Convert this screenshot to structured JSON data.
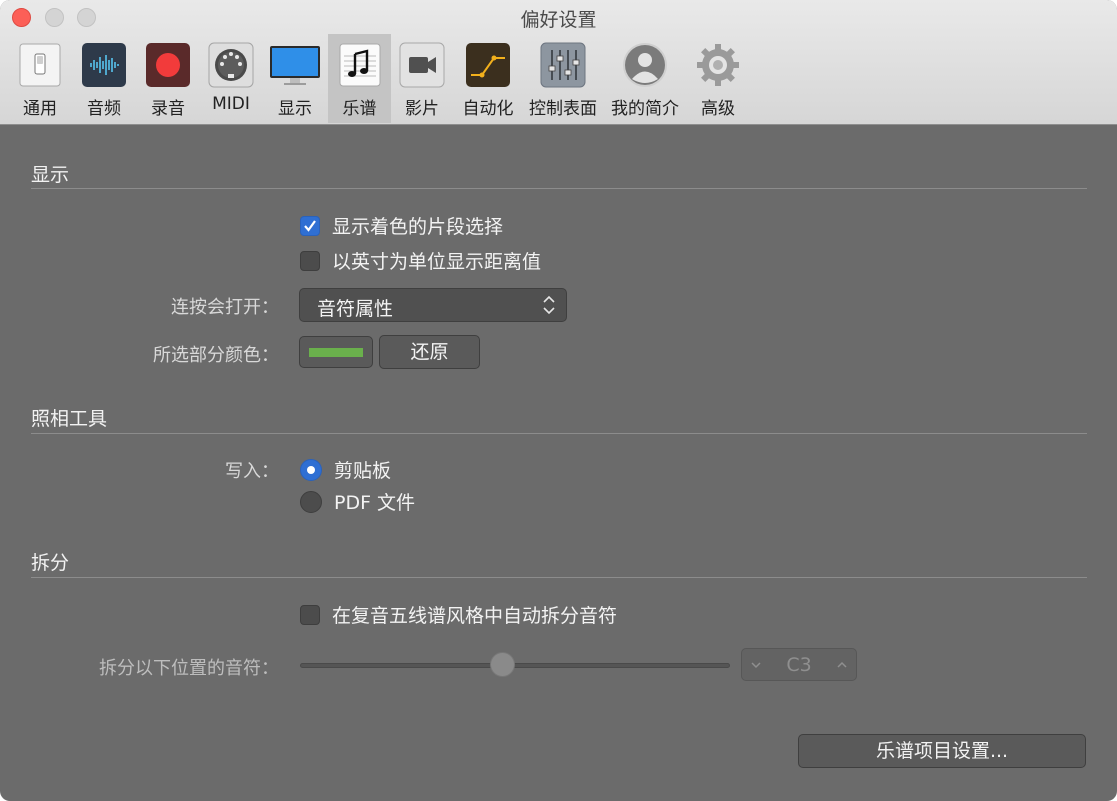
{
  "window": {
    "title": "偏好设置"
  },
  "toolbar": {
    "items": [
      {
        "label": "通用",
        "icon": "general-switch-icon"
      },
      {
        "label": "音频",
        "icon": "audio-waveform-icon"
      },
      {
        "label": "录音",
        "icon": "record-icon"
      },
      {
        "label": "MIDI",
        "icon": "midi-connector-icon"
      },
      {
        "label": "显示",
        "icon": "display-monitor-icon"
      },
      {
        "label": "乐谱",
        "icon": "score-note-icon",
        "selected": true
      },
      {
        "label": "影片",
        "icon": "movie-camera-icon"
      },
      {
        "label": "自动化",
        "icon": "automation-icon"
      },
      {
        "label": "控制表面",
        "icon": "control-surfaces-icon"
      },
      {
        "label": "我的简介",
        "icon": "user-profile-icon"
      },
      {
        "label": "高级",
        "icon": "gear-icon"
      }
    ]
  },
  "display": {
    "title": "显示",
    "colored_selection": {
      "label": "显示着色的片段选择",
      "checked": true
    },
    "inches": {
      "label": "以英寸为单位显示距离值",
      "checked": false
    },
    "double_click_label": "连按会打开：",
    "double_click_value": "音符属性",
    "selection_color_label": "所选部分颜色：",
    "selection_color": "#6ab04c",
    "revert_label": "还原"
  },
  "camera": {
    "title": "照相工具",
    "write_label": "写入：",
    "options": [
      {
        "label": "剪贴板",
        "selected": true
      },
      {
        "label": "PDF 文件",
        "selected": false
      }
    ]
  },
  "split": {
    "title": "拆分",
    "auto_split": {
      "label": "在复音五线谱风格中自动拆分音符",
      "checked": false
    },
    "split_below_label": "拆分以下位置的音符：",
    "note_value": "C3"
  },
  "footer": {
    "project_settings_label": "乐谱项目设置..."
  },
  "colors": {
    "accent": "#2f6fd3",
    "background": "#6b6b6b",
    "close": "#fc5f57"
  }
}
